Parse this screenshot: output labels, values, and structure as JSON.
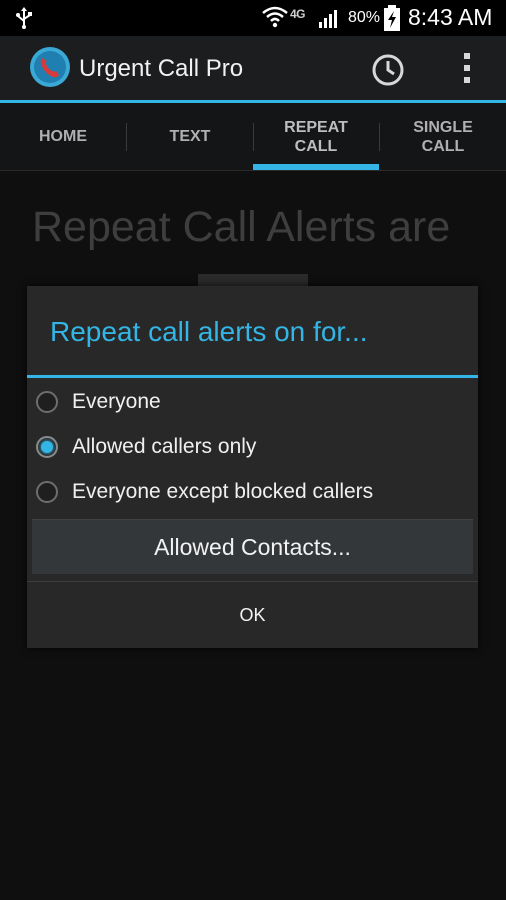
{
  "status_bar": {
    "network": "4G",
    "battery_percent": "80%",
    "time": "8:43 AM",
    "icons": [
      "usb-icon",
      "wifi-icon",
      "signal-icon",
      "battery-charging-icon"
    ]
  },
  "action_bar": {
    "title": "Urgent Call Pro",
    "icons": [
      "app-logo-phone-icon",
      "history-clock-icon",
      "overflow-menu-icon"
    ]
  },
  "tabs": [
    {
      "label": "HOME",
      "selected": false
    },
    {
      "label": "TEXT",
      "selected": false
    },
    {
      "label": "REPEAT\nCALL",
      "selected": true
    },
    {
      "label": "SINGLE\nCALL",
      "selected": false
    }
  ],
  "page": {
    "heading": "Repeat Call Alerts are"
  },
  "dialog": {
    "title": "Repeat call alerts on for...",
    "options": [
      {
        "label": "Everyone",
        "checked": false
      },
      {
        "label": "Allowed callers only",
        "checked": true
      },
      {
        "label": "Everyone except blocked callers",
        "checked": false
      }
    ],
    "contacts_button": "Allowed Contacts...",
    "ok_button": "OK"
  },
  "colors": {
    "accent": "#33b5e5",
    "background": "#0f0f0f",
    "dialog": "#282828"
  }
}
